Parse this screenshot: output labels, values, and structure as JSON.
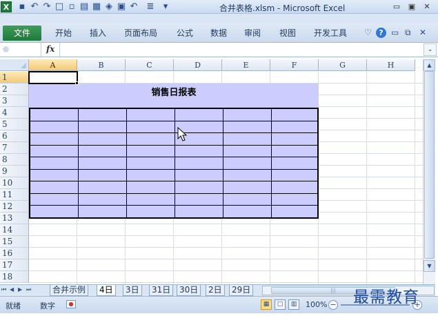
{
  "window": {
    "title": "合并表格.xlsm - Microsoft Excel",
    "minimize": "▭",
    "restore": "▣",
    "close": "✕"
  },
  "qat": {
    "logo": "X",
    "undo_arrow": "↶",
    "redo_arrow": "↷",
    "separator": "|",
    "dropdown": "▾"
  },
  "ribbon": {
    "tabs": [
      "文件",
      "开始",
      "插入",
      "页面布局",
      "公式",
      "数据",
      "审阅",
      "视图",
      "开发工具"
    ],
    "help_label": "?",
    "minimize_ribbon": "▭",
    "restore_ribbon": "⧉",
    "close_workbook": "✕",
    "collapse_arrow": "♡"
  },
  "formula_bar": {
    "fx": "fx",
    "value": "",
    "expand": "⌄"
  },
  "sheet": {
    "columns": [
      "A",
      "B",
      "C",
      "D",
      "E",
      "F",
      "G",
      "H"
    ],
    "rows": [
      "1",
      "2",
      "3",
      "4",
      "5",
      "6",
      "7",
      "8",
      "9",
      "10",
      "11",
      "12",
      "13",
      "14",
      "15",
      "16",
      "17",
      "18"
    ],
    "selected_cell": "A1",
    "report_title": "销售日报表",
    "table_fill_color": "#ccccff",
    "grid_color": "#d4dce8"
  },
  "sheet_tabs": {
    "nav": [
      "⏮",
      "◀",
      "▶",
      "⏭"
    ],
    "tabs": [
      "合并示例",
      "4日",
      "3日",
      "31日",
      "30日",
      "2日",
      "29日"
    ],
    "active_tab": "4日"
  },
  "status_bar": {
    "ready": "就绪",
    "mode": "数字",
    "zoom": "100%",
    "zoom_out": "−",
    "zoom_in": "+"
  },
  "watermark": "最需教育",
  "colors": {
    "excel_green": "#1f7c3b",
    "ribbon_blue": "#cbdaee",
    "header_blue": "#dfe7f2",
    "selection_orange": "#f4c978"
  }
}
